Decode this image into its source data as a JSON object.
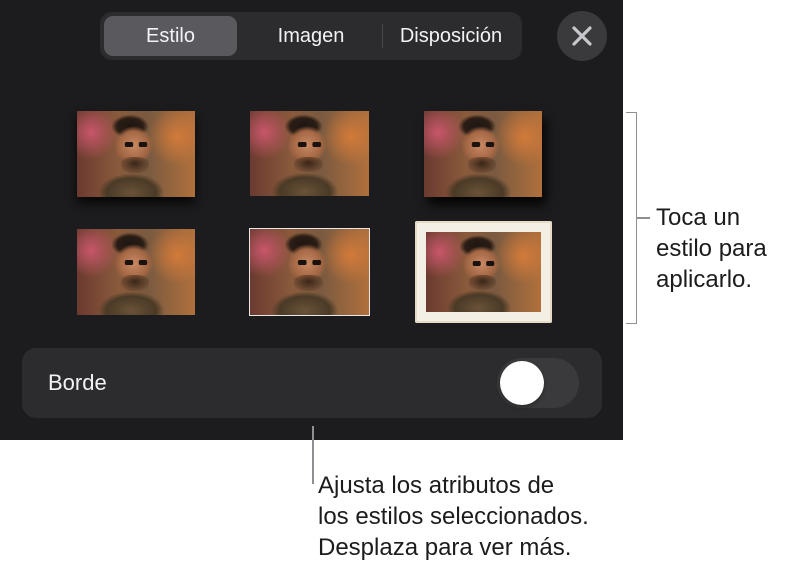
{
  "tabs": [
    {
      "label": "Estilo",
      "active": true
    },
    {
      "label": "Imagen",
      "active": false
    },
    {
      "label": "Disposición",
      "active": false
    }
  ],
  "close_icon": "close-icon",
  "styles": [
    {
      "name": "shadow"
    },
    {
      "name": "reflection"
    },
    {
      "name": "drop-shadow"
    },
    {
      "name": "plain"
    },
    {
      "name": "thin-border"
    },
    {
      "name": "cream-frame"
    }
  ],
  "border_row": {
    "label": "Borde",
    "toggle_on": false
  },
  "callouts": {
    "right": [
      "Toca un",
      "estilo para",
      "aplicarlo."
    ],
    "bottom": [
      "Ajusta los atributos de",
      "los estilos seleccionados.",
      "Desplaza para ver más."
    ]
  },
  "colors": {
    "panel": "#1c1c1e",
    "segment_bg": "#2c2c2e",
    "segment_active": "#5a5a5e",
    "toggle_off": "#3a3a3c"
  }
}
